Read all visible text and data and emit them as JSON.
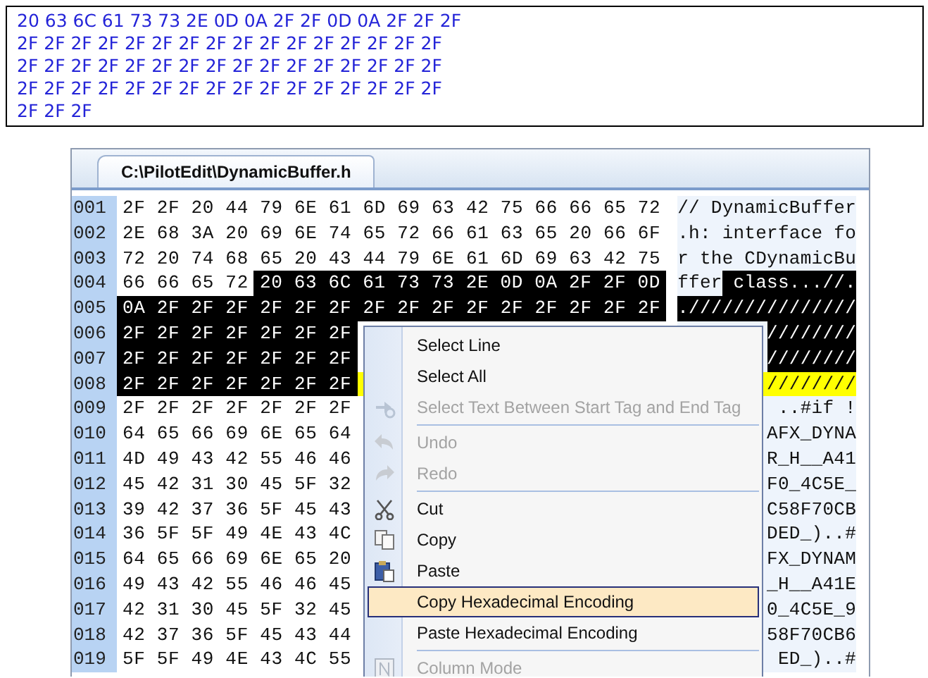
{
  "clipboard_text": {
    "lines": [
      "20 63 6C 61 73 73 2E 0D 0A 2F 2F 0D 0A 2F 2F 2F",
      "2F 2F 2F 2F 2F 2F 2F 2F 2F 2F 2F 2F 2F 2F 2F 2F",
      "2F 2F 2F 2F 2F 2F 2F 2F 2F 2F 2F 2F 2F 2F 2F 2F",
      "2F 2F 2F 2F 2F 2F 2F 2F 2F 2F 2F 2F 2F 2F 2F 2F",
      "2F 2F 2F"
    ]
  },
  "editor": {
    "tabs": [
      {
        "label": "C:\\PilotEdit\\DynamicBuffer.h",
        "selected": true
      }
    ],
    "rows": [
      {
        "number": "001",
        "current": false,
        "hex": [
          {
            "text": "2F 2F 20 44 79 6E 61 6D 69 63 42 75 66 66 65 72",
            "selected": false
          }
        ],
        "ascii": [
          {
            "text": "// DynamicBuffer",
            "selected": false
          }
        ]
      },
      {
        "number": "002",
        "current": false,
        "hex": [
          {
            "text": "2E 68 3A 20 69 6E 74 65 72 66 61 63 65 20 66 6F",
            "selected": false
          }
        ],
        "ascii": [
          {
            "text": ".h: interface fo",
            "selected": false
          }
        ]
      },
      {
        "number": "003",
        "current": false,
        "hex": [
          {
            "text": "72 20 74 68 65 20 43 44 79 6E 61 6D 69 63 42 75",
            "selected": false
          }
        ],
        "ascii": [
          {
            "text": "r the CDynamicBu",
            "selected": false
          }
        ]
      },
      {
        "number": "004",
        "current": false,
        "hex": [
          {
            "text": "66 66 65 72",
            "selected": false
          },
          {
            "text": "20 63 6C 61 73 73 2E 0D 0A 2F 2F 0D",
            "selected": true
          }
        ],
        "ascii": [
          {
            "text": "ffer",
            "selected": false
          },
          {
            "text": " class...//.",
            "selected": true
          }
        ]
      },
      {
        "number": "005",
        "current": false,
        "hex": [
          {
            "text": "0A 2F 2F 2F 2F 2F 2F 2F 2F 2F 2F 2F 2F 2F 2F 2F",
            "selected": true
          }
        ],
        "ascii": [
          {
            "text": ".///////////////",
            "selected": true
          }
        ]
      },
      {
        "number": "006",
        "current": false,
        "hex": [
          {
            "text": "2F 2F 2F 2F 2F 2F 2F",
            "selected": true
          }
        ],
        "ascii": [
          {
            "text": "////////",
            "selected": true
          }
        ]
      },
      {
        "number": "007",
        "current": false,
        "hex": [
          {
            "text": "2F 2F 2F 2F 2F 2F 2F",
            "selected": true
          }
        ],
        "ascii": [
          {
            "text": "////////",
            "selected": true
          }
        ]
      },
      {
        "number": "008",
        "current": true,
        "hex": [
          {
            "text": "2F 2F 2F 2F 2F 2F 2F",
            "selected": true
          }
        ],
        "ascii": [
          {
            "text": "////////",
            "selected": false
          }
        ]
      },
      {
        "number": "009",
        "current": false,
        "hex": [
          {
            "text": "2F 2F 2F 2F 2F 2F 2F",
            "selected": false
          }
        ],
        "ascii": [
          {
            "text": "..#if !",
            "selected": false
          }
        ]
      },
      {
        "number": "010",
        "current": false,
        "hex": [
          {
            "text": "64 65 66 69 6E 65 64",
            "selected": false
          }
        ],
        "ascii": [
          {
            "text": "AFX_DYNA",
            "selected": false
          }
        ]
      },
      {
        "number": "011",
        "current": false,
        "hex": [
          {
            "text": "4D 49 43 42 55 46 46",
            "selected": false
          }
        ],
        "ascii": [
          {
            "text": "R_H__A41",
            "selected": false
          }
        ]
      },
      {
        "number": "012",
        "current": false,
        "hex": [
          {
            "text": "45 42 31 30 45 5F 32",
            "selected": false
          }
        ],
        "ascii": [
          {
            "text": "F0_4C5E_",
            "selected": false
          }
        ]
      },
      {
        "number": "013",
        "current": false,
        "hex": [
          {
            "text": "39 42 37 36 5F 45 43",
            "selected": false
          }
        ],
        "ascii": [
          {
            "text": "C58F70CB",
            "selected": false
          }
        ]
      },
      {
        "number": "014",
        "current": false,
        "hex": [
          {
            "text": "36 5F 5F 49 4E 43 4C",
            "selected": false
          }
        ],
        "ascii": [
          {
            "text": "DED_)..#",
            "selected": false
          }
        ]
      },
      {
        "number": "015",
        "current": false,
        "hex": [
          {
            "text": "64 65 66 69 6E 65 20",
            "selected": false
          }
        ],
        "ascii": [
          {
            "text": "FX_DYNAM",
            "selected": false
          }
        ]
      },
      {
        "number": "016",
        "current": false,
        "hex": [
          {
            "text": "49 43 42 55 46 46 45",
            "selected": false
          }
        ],
        "ascii": [
          {
            "text": "_H__A41E",
            "selected": false
          }
        ]
      },
      {
        "number": "017",
        "current": false,
        "hex": [
          {
            "text": "42 31 30 45 5F 32 45",
            "selected": false
          }
        ],
        "ascii": [
          {
            "text": "0_4C5E_9",
            "selected": false
          }
        ]
      },
      {
        "number": "018",
        "current": false,
        "hex": [
          {
            "text": "42 37 36 5F 45 43 44",
            "selected": false
          }
        ],
        "ascii": [
          {
            "text": "58F70CB6",
            "selected": false
          }
        ]
      },
      {
        "number": "019",
        "current": false,
        "hex": [
          {
            "text": "5F 5F 49 4E 43 4C 55",
            "selected": false
          }
        ],
        "ascii": [
          {
            "text": "ED_)..#",
            "selected": false
          }
        ]
      }
    ]
  },
  "context_menu": {
    "items": [
      {
        "kind": "item",
        "label": "Select Line",
        "disabled": false,
        "selected": false
      },
      {
        "kind": "item",
        "label": "Select All",
        "disabled": false,
        "selected": false
      },
      {
        "kind": "item",
        "label": "Select Text Between Start Tag and End Tag",
        "disabled": true,
        "selected": false
      },
      {
        "kind": "separator"
      },
      {
        "kind": "item",
        "label": "Undo",
        "disabled": true,
        "selected": false
      },
      {
        "kind": "item",
        "label": "Redo",
        "disabled": true,
        "selected": false
      },
      {
        "kind": "separator"
      },
      {
        "kind": "item",
        "label": "Cut",
        "disabled": false,
        "selected": false
      },
      {
        "kind": "item",
        "label": "Copy",
        "disabled": false,
        "selected": false
      },
      {
        "kind": "item",
        "label": "Paste",
        "disabled": false,
        "selected": false
      },
      {
        "kind": "item",
        "label": "Copy Hexadecimal Encoding",
        "disabled": false,
        "selected": true
      },
      {
        "kind": "item",
        "label": "Paste Hexadecimal Encoding",
        "disabled": false,
        "selected": false
      },
      {
        "kind": "separator"
      },
      {
        "kind": "item",
        "label": "Column Mode",
        "disabled": true,
        "selected": false
      }
    ]
  }
}
